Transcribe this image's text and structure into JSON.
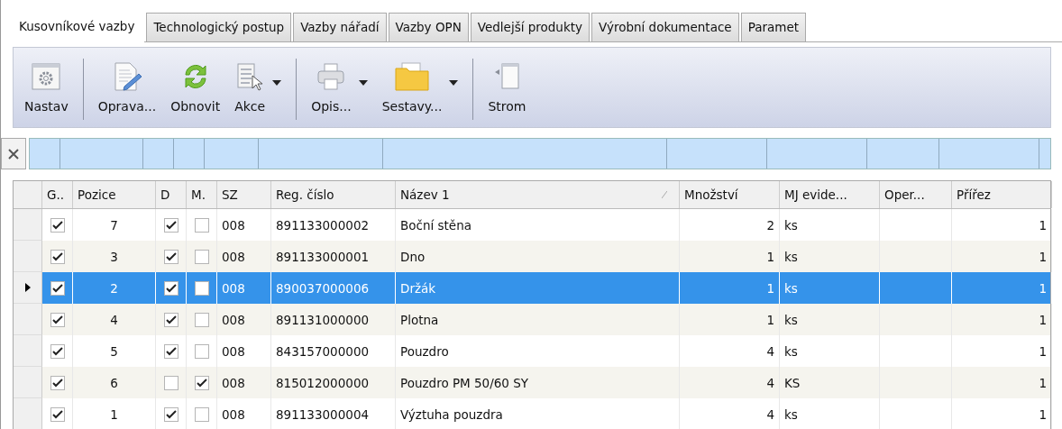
{
  "tabs": [
    {
      "label": "Kusovníkové vazby",
      "selected": true
    },
    {
      "label": "Technologický postup",
      "selected": false
    },
    {
      "label": "Vazby nářadí",
      "selected": false
    },
    {
      "label": "Vazby OPN",
      "selected": false
    },
    {
      "label": "Vedlejší produkty",
      "selected": false
    },
    {
      "label": "Výrobní dokumentace",
      "selected": false
    },
    {
      "label": "Paramet",
      "selected": false
    }
  ],
  "toolbar": [
    [
      {
        "label": "Nastav",
        "dropdown": false
      }
    ],
    [
      {
        "label": "Oprava...",
        "dropdown": false
      },
      {
        "label": "Obnovit",
        "dropdown": false
      },
      {
        "label": "Akce",
        "dropdown": true
      }
    ],
    [
      {
        "label": "Opis...",
        "dropdown": true
      },
      {
        "label": "Sestavy...",
        "dropdown": true
      }
    ],
    [
      {
        "label": "Strom",
        "dropdown": false
      }
    ]
  ],
  "table": {
    "columns": [
      {
        "label": "G..",
        "sorted": false
      },
      {
        "label": "Pozice",
        "sorted": false
      },
      {
        "label": "D",
        "sorted": false
      },
      {
        "label": "M.",
        "sorted": false
      },
      {
        "label": "SZ",
        "sorted": false
      },
      {
        "label": "Reg. číslo",
        "sorted": false
      },
      {
        "label": "Název 1",
        "sorted": true
      },
      {
        "label": "Množství",
        "sorted": false
      },
      {
        "label": "MJ evide...",
        "sorted": false
      },
      {
        "label": "Oper...",
        "sorted": false
      },
      {
        "label": "Přířez",
        "sorted": false
      }
    ],
    "rows": [
      {
        "selected": false,
        "g": true,
        "pozice": "7",
        "d": true,
        "m": false,
        "sz": "008",
        "reg": "891133000002",
        "nazev": "Boční stěna",
        "mnozstvi": "2",
        "mj": "ks",
        "prirez": "1"
      },
      {
        "selected": false,
        "g": true,
        "pozice": "3",
        "d": true,
        "m": false,
        "sz": "008",
        "reg": "891133000001",
        "nazev": "Dno",
        "mnozstvi": "1",
        "mj": "ks",
        "prirez": "1"
      },
      {
        "selected": true,
        "g": true,
        "pozice": "2",
        "d": true,
        "m": false,
        "sz": "008",
        "reg": "890037000006",
        "nazev": "Držák",
        "mnozstvi": "1",
        "mj": "ks",
        "prirez": "1"
      },
      {
        "selected": false,
        "g": true,
        "pozice": "4",
        "d": true,
        "m": false,
        "sz": "008",
        "reg": "891131000000",
        "nazev": "Plotna",
        "mnozstvi": "1",
        "mj": "ks",
        "prirez": "1"
      },
      {
        "selected": false,
        "g": true,
        "pozice": "5",
        "d": true,
        "m": false,
        "sz": "008",
        "reg": "843157000000",
        "nazev": "Pouzdro",
        "mnozstvi": "4",
        "mj": "ks",
        "prirez": "1"
      },
      {
        "selected": false,
        "g": true,
        "pozice": "6",
        "d": false,
        "m": true,
        "sz": "008",
        "reg": "815012000000",
        "nazev": "Pouzdro PM 50/60 SY",
        "mnozstvi": "4",
        "mj": "KS",
        "prirez": "1"
      },
      {
        "selected": false,
        "g": true,
        "pozice": "1",
        "d": true,
        "m": false,
        "sz": "008",
        "reg": "891133000004",
        "nazev": "Výztuha pouzdra",
        "mnozstvi": "4",
        "mj": "ks",
        "prirez": "1"
      }
    ]
  }
}
